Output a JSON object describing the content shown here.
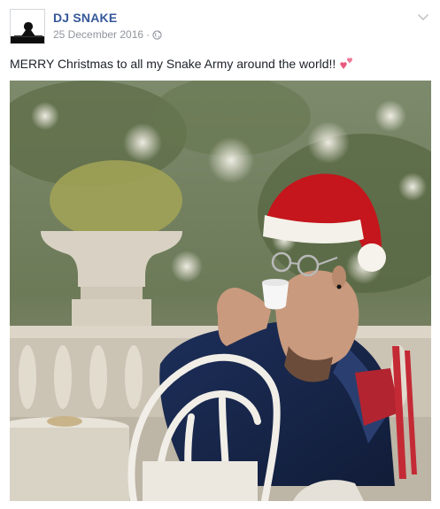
{
  "post": {
    "author": "DJ SNAKE",
    "date": "25 December 2016",
    "separator": "·",
    "privacy_icon": "globe-icon",
    "menu_icon": "chevron-down-icon",
    "text": "MERRY Christmas to all my Snake Army around the world!!",
    "emoji_icon": "two-hearts-icon"
  },
  "colors": {
    "author_link": "#365899",
    "meta_gray": "#90949c",
    "text": "#1d2129",
    "heart": "#e85a7d"
  }
}
